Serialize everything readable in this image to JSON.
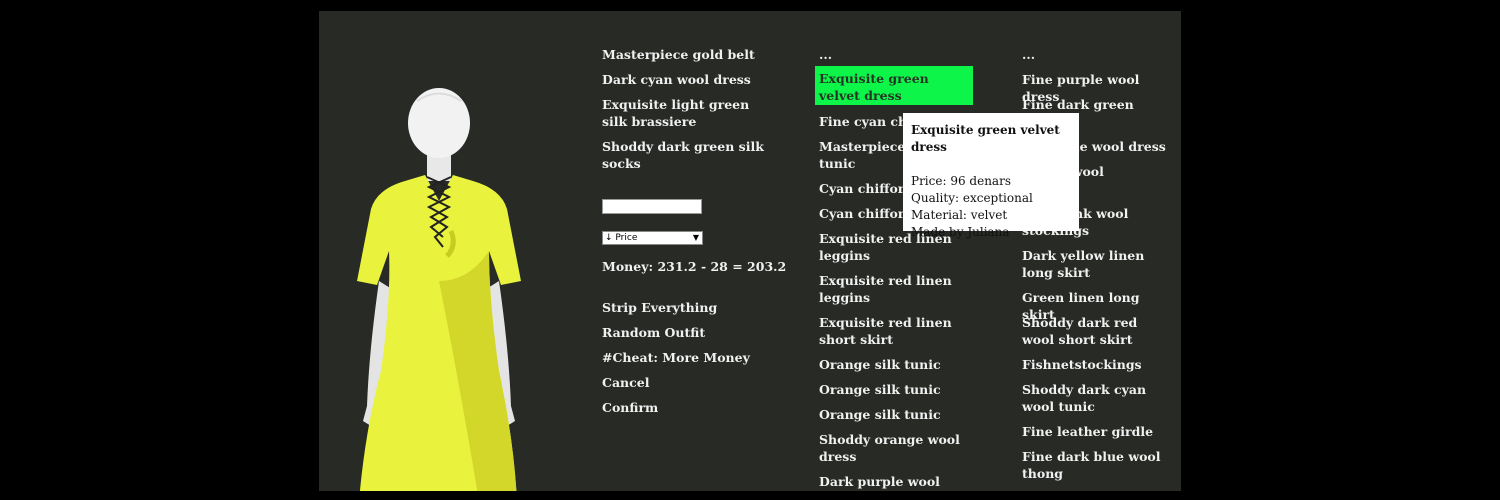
{
  "equipped": [
    "Masterpiece gold belt",
    "Dark cyan wool dress",
    "Exquisite light green silk brassiere",
    "Shoddy dark green silk socks"
  ],
  "search": {
    "value": "",
    "placeholder": ""
  },
  "sort": {
    "selected": "↓ Price"
  },
  "money": "Money: 231.2 - 28 = 203.2",
  "actions": [
    "Strip Everything",
    "Random Outfit",
    "#Cheat: More Money",
    "Cancel",
    "Confirm"
  ],
  "shop_col1": [
    "...",
    "Exquisite green velvet dress",
    "Fine cyan chiffon",
    "Masterpiece green tunic",
    "Cyan chiffon shirt",
    "Cyan chiffon shirt",
    "Exquisite red linen leggins",
    "Exquisite red linen leggins",
    "Exquisite red linen short skirt",
    "Orange silk tunic",
    "Orange silk tunic",
    "Orange silk tunic",
    "Shoddy orange wool dress",
    "Dark purple wool long"
  ],
  "shop_col2": [
    "...",
    "Fine purple wool dress",
    "Fine dark green linen",
    "Fine blue wool dress",
    "Brown wool",
    "Dark pink wool stockings",
    "Dark yellow linen long skirt",
    "Green linen long skirt",
    "Shoddy dark red wool short skirt",
    "Fishnetstockings",
    "Shoddy dark cyan wool tunic",
    "Fine leather girdle",
    "Fine dark blue wool thong"
  ],
  "tooltip": {
    "title": "Exquisite green velvet dress",
    "price": "Price: 96 denars",
    "quality": "Quality: exceptional",
    "material": "Material: velvet",
    "maker": "Made by Juliana"
  },
  "colors": {
    "background": "#272a25",
    "selected_item": "#0ef54a",
    "dress": "#e9f23c"
  }
}
